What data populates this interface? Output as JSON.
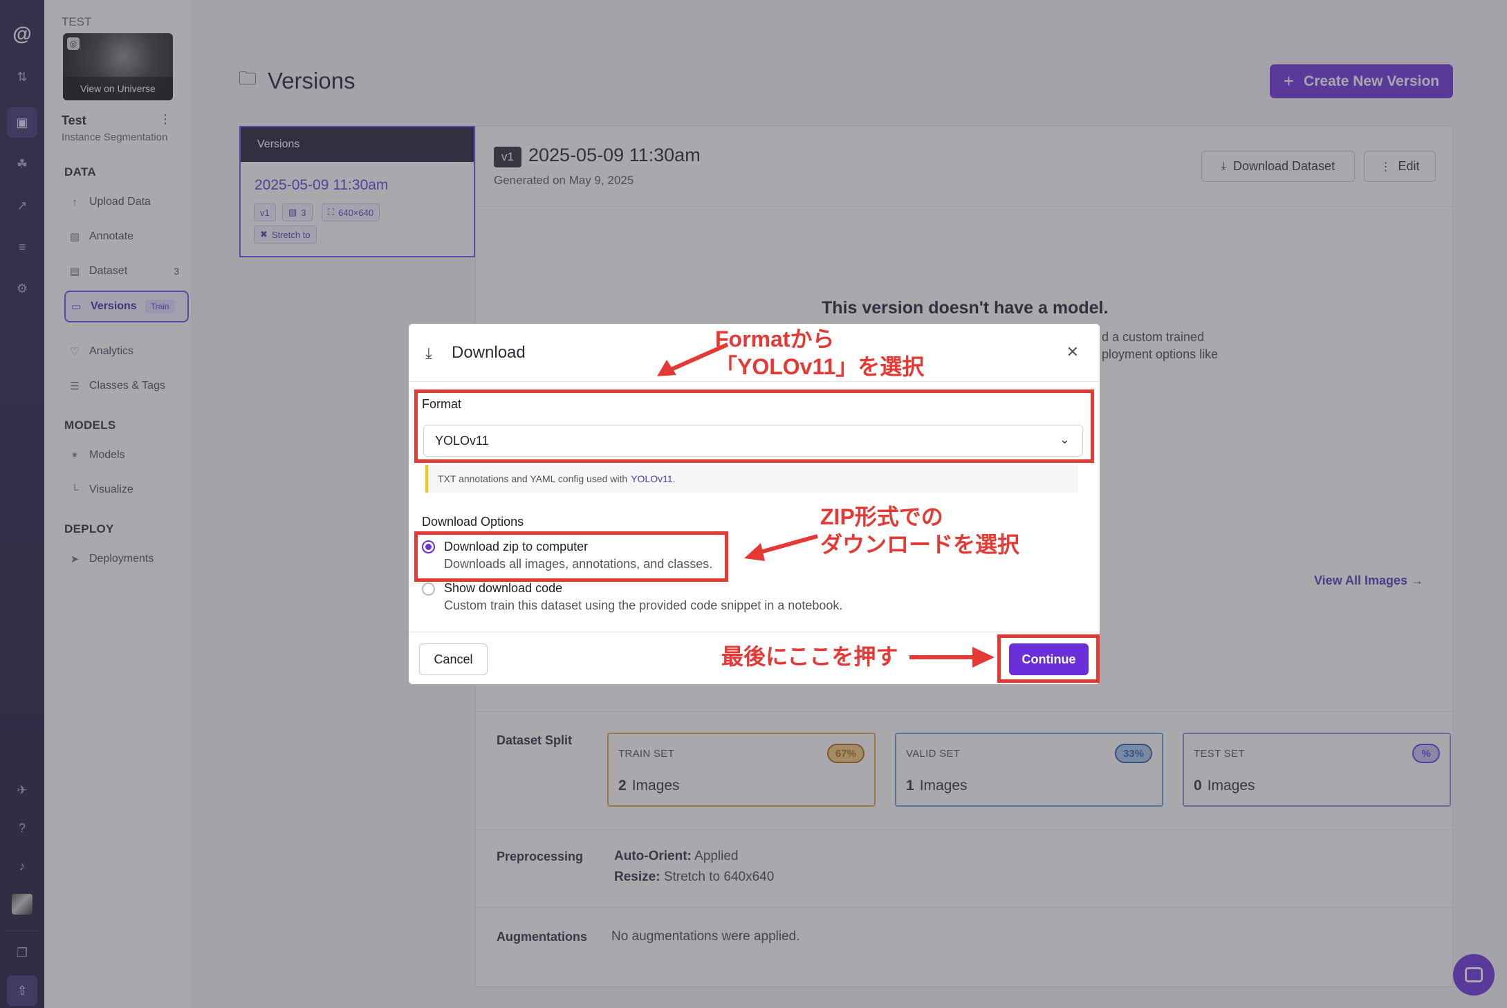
{
  "sidebar": {
    "project_label": "TEST",
    "view_on_universe": "View on Universe",
    "project_title": "Test",
    "project_type": "Instance Segmentation",
    "sections": {
      "data": "DATA",
      "models": "MODELS",
      "deploy": "DEPLOY"
    },
    "items": [
      {
        "label": "Upload Data",
        "icon": "upload-arrow-icon"
      },
      {
        "label": "Annotate",
        "icon": "image-icon"
      },
      {
        "label": "Dataset",
        "icon": "images-icon",
        "count": "3"
      },
      {
        "label": "Versions",
        "icon": "folder-icon",
        "pill": "Train"
      },
      {
        "label": "Analytics",
        "icon": "heart-pulse-icon"
      },
      {
        "label": "Classes & Tags",
        "icon": "list-icon"
      },
      {
        "label": "Models",
        "icon": "network-icon"
      },
      {
        "label": "Visualize",
        "icon": "chart-icon"
      },
      {
        "label": "Deployments",
        "icon": "rocket-icon"
      }
    ]
  },
  "header": {
    "title": "Versions",
    "create_button": "Create New Version"
  },
  "versions_panel": {
    "heading": "Versions",
    "version_date": "2025-05-09 11:30am",
    "tags": [
      "v1",
      "3",
      "640×640",
      "Stretch to"
    ]
  },
  "version_detail": {
    "badge": "v1",
    "title": "2025-05-09 11:30am",
    "generated": "Generated on May 9, 2025",
    "download_button": "Download Dataset",
    "edit_button": "Edit",
    "no_model_title": "This version doesn't have a model.",
    "no_model_line1": "d a custom trained",
    "no_model_line2": "ployment options like",
    "view_all_images": "View All Images →",
    "dataset_split_label": "Dataset Split",
    "splits": [
      {
        "name": "TRAIN SET",
        "percent": "67%",
        "count": "2",
        "unit": "Images",
        "color": "#e8a23a",
        "pill_bg": "#f6c97a",
        "pill_text": "#b06b10"
      },
      {
        "name": "VALID SET",
        "percent": "33%",
        "count": "1",
        "unit": "Images",
        "color": "#6e9ad8",
        "pill_bg": "#a7c6f0",
        "pill_text": "#2c5ea8"
      },
      {
        "name": "TEST SET",
        "percent": "%",
        "count": "0",
        "unit": "Images",
        "color": "#8f86d8",
        "pill_bg": "#c9c1f3",
        "pill_text": "#5a3fe0"
      }
    ],
    "preprocessing_label": "Preprocessing",
    "preprocessing": [
      {
        "key": "Auto-Orient:",
        "value": "Applied"
      },
      {
        "key": "Resize:",
        "value": "Stretch to 640x640"
      }
    ],
    "augmentations_label": "Augmentations",
    "augmentations_value": "No augmentations were applied."
  },
  "modal": {
    "title": "Download",
    "format_label": "Format",
    "format_value": "YOLOv11",
    "format_hint": "TXT annotations and YAML config used with",
    "format_hint_link": "YOLOv11",
    "format_hint_end": ".",
    "download_options_label": "Download Options",
    "options": [
      {
        "title": "Download zip to computer",
        "desc": "Downloads all images, annotations, and classes.",
        "selected": true
      },
      {
        "title": "Show download code",
        "desc": "Custom train this dataset using the provided code snippet in a notebook.",
        "selected": false
      }
    ],
    "cancel": "Cancel",
    "continue": "Continue"
  },
  "annotations": {
    "format_note_line1": "Formatから",
    "format_note_line2": "「YOLOv11」を選択",
    "zip_note_line1": "ZIP形式での",
    "zip_note_line2": "ダウンロードを選択",
    "continue_note": "最後にここを押す",
    "color": "#e53935"
  },
  "colors": {
    "accent": "#6b2fd9",
    "rail": "#262148"
  }
}
